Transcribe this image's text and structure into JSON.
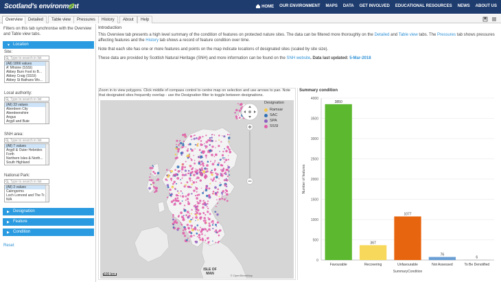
{
  "header": {
    "logo_text": "Scotland's environment",
    "nav": [
      "HOME",
      "OUR ENVIRONMENT",
      "MAPS",
      "DATA",
      "GET INVOLVED",
      "EDUCATIONAL RESOURCES",
      "NEWS",
      "ABOUT US"
    ],
    "bg_color": "#1f3c6e"
  },
  "tabs": [
    "Overview",
    "Detailed",
    "Table view",
    "Pressures",
    "History",
    "About",
    "Help"
  ],
  "active_tab": "Overview",
  "left": {
    "intro": "Filters on this tab synchronise with the Overview and Table view tabs.",
    "location_label": "Location",
    "site": {
      "label": "Site:",
      "placeholder": "Type to search in list",
      "items": [
        "(All) 1866 values",
        "A' Mhoine (SSSI)",
        "Abbey Burn Foot to B...",
        "Abbey Craig (SSSI)",
        "Abbey St Bathans Wo..."
      ]
    },
    "la": {
      "label": "Local authority:",
      "placeholder": "Type to search in list",
      "items": [
        "(All) 33 values",
        "Aberdeen City",
        "Aberdeenshire",
        "Angus",
        "Argyll and Bute"
      ]
    },
    "snh": {
      "label": "SNH area:",
      "placeholder": "Type to search in list",
      "items": [
        "(All) 7 values",
        "Argyll & Outer Hebrides",
        "Forth",
        "Northern Isles & North...",
        "South Highland"
      ]
    },
    "np": {
      "label": "National Park:",
      "placeholder": "Type to search in list",
      "items": [
        "(All) 3 values",
        "Cairngorms",
        "Loch Lomond and The Tr...",
        "N/A"
      ]
    },
    "sections": [
      "Designation",
      "Feature",
      "Condition"
    ],
    "reset": "Reset",
    "accent": "#2a9be0"
  },
  "intro": {
    "heading": "Introduction",
    "p1_a": "This Overview tab presents a high level summary of the condition of features on protected nature sites. The data can be filtered more thoroughly on the ",
    "p1_l1": "Detailed",
    "p1_b": " and ",
    "p1_l2": "Table view",
    "p1_c": " tabs. The ",
    "p1_l3": "Pressures",
    "p1_d": " tab shows pressures affecting features and the ",
    "p1_l4": "History",
    "p1_e": " tab shows a record of feature condition over time.",
    "p2": "Note that each site has one or more features and points on the map indicate locations of designated sites (scaled by site size).",
    "p3_a": "These data are provided by Scottish Natural Heritage (SNH) and more information can be found on the ",
    "p3_link": "SNH website",
    "p3_b": ". Data last updated: ",
    "p3_date": "5-Mar-2018"
  },
  "map": {
    "note": "Zoom in to view polygons. Click middle of compass control to centre map on selection and use arrows to pan. Note that designated sites frequently overlap - use the Designation filter to toggle between designations.",
    "legend_title": "Designation",
    "legend": [
      {
        "label": "Ramsar",
        "color": "#f2c84b"
      },
      {
        "label": "SAC",
        "color": "#2f6fb5"
      },
      {
        "label": "SPA",
        "color": "#8b5fbf"
      },
      {
        "label": "SSSI",
        "color": "#e05aa8"
      }
    ],
    "scale": "100 km",
    "label_isle": "ISLE OF MAN",
    "attribution": "© OpenStreetMap"
  },
  "chart_data": {
    "type": "bar",
    "title": "Summary condition",
    "xlabel": "SummaryCondition",
    "ylabel": "Number of features",
    "categories": [
      "Favourable",
      "Recovering",
      "Unfavourable",
      "Not Assessed",
      "To Be Denotified"
    ],
    "values": [
      3850,
      367,
      1077,
      76,
      6
    ],
    "colors": [
      "#5cb82e",
      "#f7d85a",
      "#e8650f",
      "#6a9fd4",
      "#aaaaaa"
    ],
    "ylim": [
      0,
      4000
    ],
    "yticks": [
      0,
      500,
      1000,
      1500,
      2000,
      2500,
      3000,
      3500,
      4000
    ],
    "grid": true
  }
}
